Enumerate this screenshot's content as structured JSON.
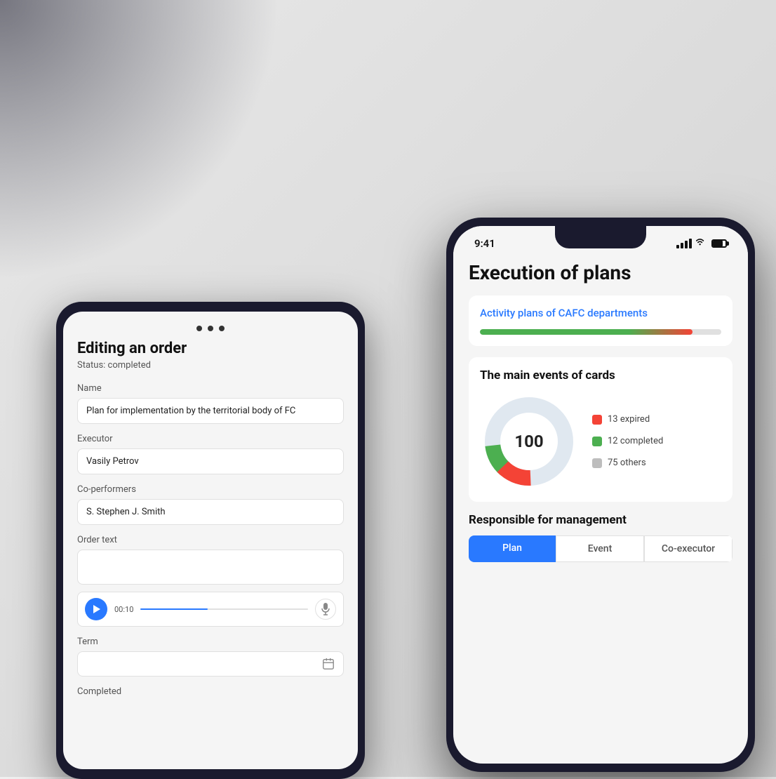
{
  "background": {
    "color": "#e0e0e0"
  },
  "android_phone": {
    "title": "Editing an order",
    "status": "Status: completed",
    "fields": {
      "name_label": "Name",
      "name_value": "Plan for implementation by the territorial body of FC",
      "executor_label": "Executor",
      "executor_value": "Vasily Petrov",
      "co_performers_label": "Co-performers",
      "co_performers_value": "S. Stephen  J. Smith",
      "order_text_label": "Order text",
      "audio_time": "00:10",
      "term_label": "Term",
      "completed_label": "Completed"
    }
  },
  "ios_phone": {
    "status_bar": {
      "time": "9:41"
    },
    "page_title": "Execution of plans",
    "activity_card": {
      "title": "Activity plans of CAFC departments",
      "progress_percent": 88
    },
    "events_card": {
      "title": "The main events of cards",
      "donut_center": "100",
      "legend": [
        {
          "label": "13 expired",
          "color": "#f44336"
        },
        {
          "label": "12 completed",
          "color": "#4caf50"
        },
        {
          "label": "75 others",
          "color": "#bdbdbd"
        }
      ]
    },
    "responsible": {
      "title": "Responsible for management",
      "tabs": [
        "Plan",
        "Event",
        "Co-executor"
      ]
    }
  }
}
